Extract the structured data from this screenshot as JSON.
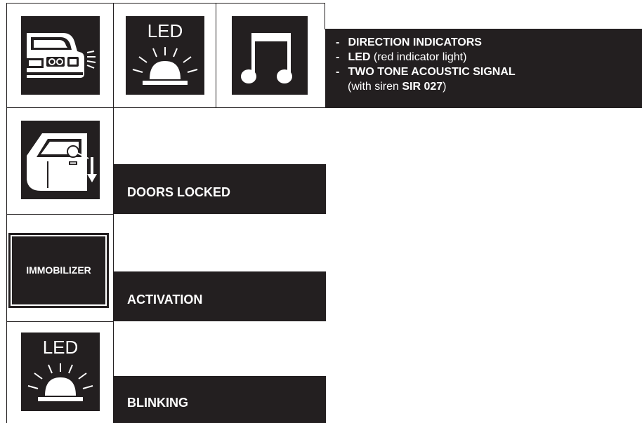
{
  "header_row": {
    "icons": [
      "car-front-lights-icon",
      "led-indicator-icon",
      "music-note-icon"
    ],
    "led_label": "LED",
    "description": {
      "line1_dash": "-",
      "line1_bold": "DIRECTION INDICATORS",
      "line2_dash": "-",
      "line2_bold": "LED",
      "line2_text": " (red indicator light)",
      "line3_dash": "-",
      "line3_bold": "TWO TONE ACOUSTIC SIGNAL",
      "line4_text_a": "(with siren ",
      "line4_bold": "SIR 027",
      "line4_text_b": ")"
    }
  },
  "rows": [
    {
      "icon": "car-door-lock-icon",
      "label": "DOORS LOCKED"
    },
    {
      "icon": "immobilizer-icon",
      "icon_text": "IMMOBILIZER",
      "label": "ACTIVATION"
    },
    {
      "icon": "led-indicator-icon",
      "icon_text": "LED",
      "label": "BLINKING"
    }
  ]
}
